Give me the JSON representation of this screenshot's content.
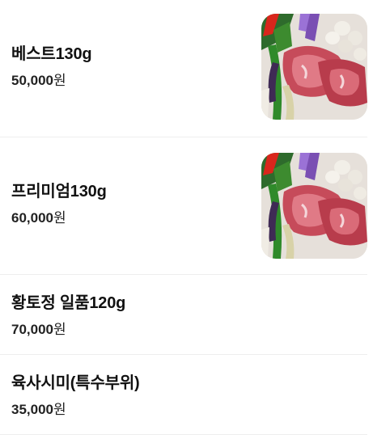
{
  "menu": {
    "items": [
      {
        "name": "베스트130g",
        "price": "50,000",
        "currency": "원",
        "image": "beef-platter-photo"
      },
      {
        "name": "프리미엄130g",
        "price": "60,000",
        "currency": "원",
        "image": "beef-platter-photo"
      },
      {
        "name": "황토정 일품120g",
        "price": "70,000",
        "currency": "원"
      },
      {
        "name": "육사시미(특수부위)",
        "price": "35,000",
        "currency": "원"
      }
    ]
  }
}
